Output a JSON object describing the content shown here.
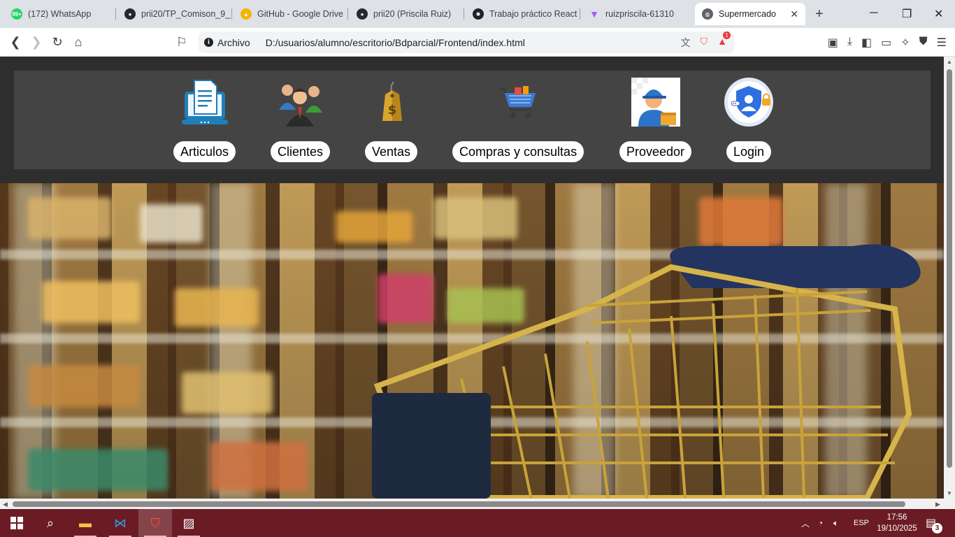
{
  "browser": {
    "tabs": [
      {
        "label": "(172) WhatsApp",
        "icon": "whatsapp-icon",
        "color": "#25d366",
        "badge": "99+"
      },
      {
        "label": "prii20/TP_Comison_9_",
        "icon": "github-icon",
        "color": "#24292e"
      },
      {
        "label": "GitHub - Google Drive",
        "icon": "google-drive-icon",
        "color": "#4285f4"
      },
      {
        "label": "prii20 (Priscila Ruiz)",
        "icon": "github-icon",
        "color": "#24292e"
      },
      {
        "label": "Trabajo práctico React",
        "icon": "openai-icon",
        "color": "#202124"
      },
      {
        "label": "ruizpriscila-61310",
        "icon": "vite-icon",
        "color": "#a259ff"
      },
      {
        "label": "Supermercado",
        "icon": "globe-icon",
        "color": "#5f6368",
        "active": true
      }
    ],
    "address": {
      "scheme_label": "Archivo",
      "url": "D:/usuarios/alumno/escritorio/Bdparcial/Frontend/index.html"
    },
    "shield_badge": "1"
  },
  "page": {
    "menu": [
      {
        "label": "Articulos",
        "icon": "document-laptop-icon"
      },
      {
        "label": "Clientes",
        "icon": "people-group-icon"
      },
      {
        "label": "Ventas",
        "icon": "price-tag-icon"
      },
      {
        "label": "Compras y consultas",
        "icon": "shopping-cart-icon"
      },
      {
        "label": "Proveedor",
        "icon": "delivery-worker-icon"
      },
      {
        "label": "Login",
        "icon": "user-shield-icon"
      }
    ]
  },
  "taskbar": {
    "language": "ESP",
    "time": "17:56",
    "date": "19/10/2025",
    "notifications": "3"
  },
  "colors": {
    "page_background": "#2e2e2e",
    "menu_background": "#444444",
    "taskbar": "#6b1b24"
  }
}
